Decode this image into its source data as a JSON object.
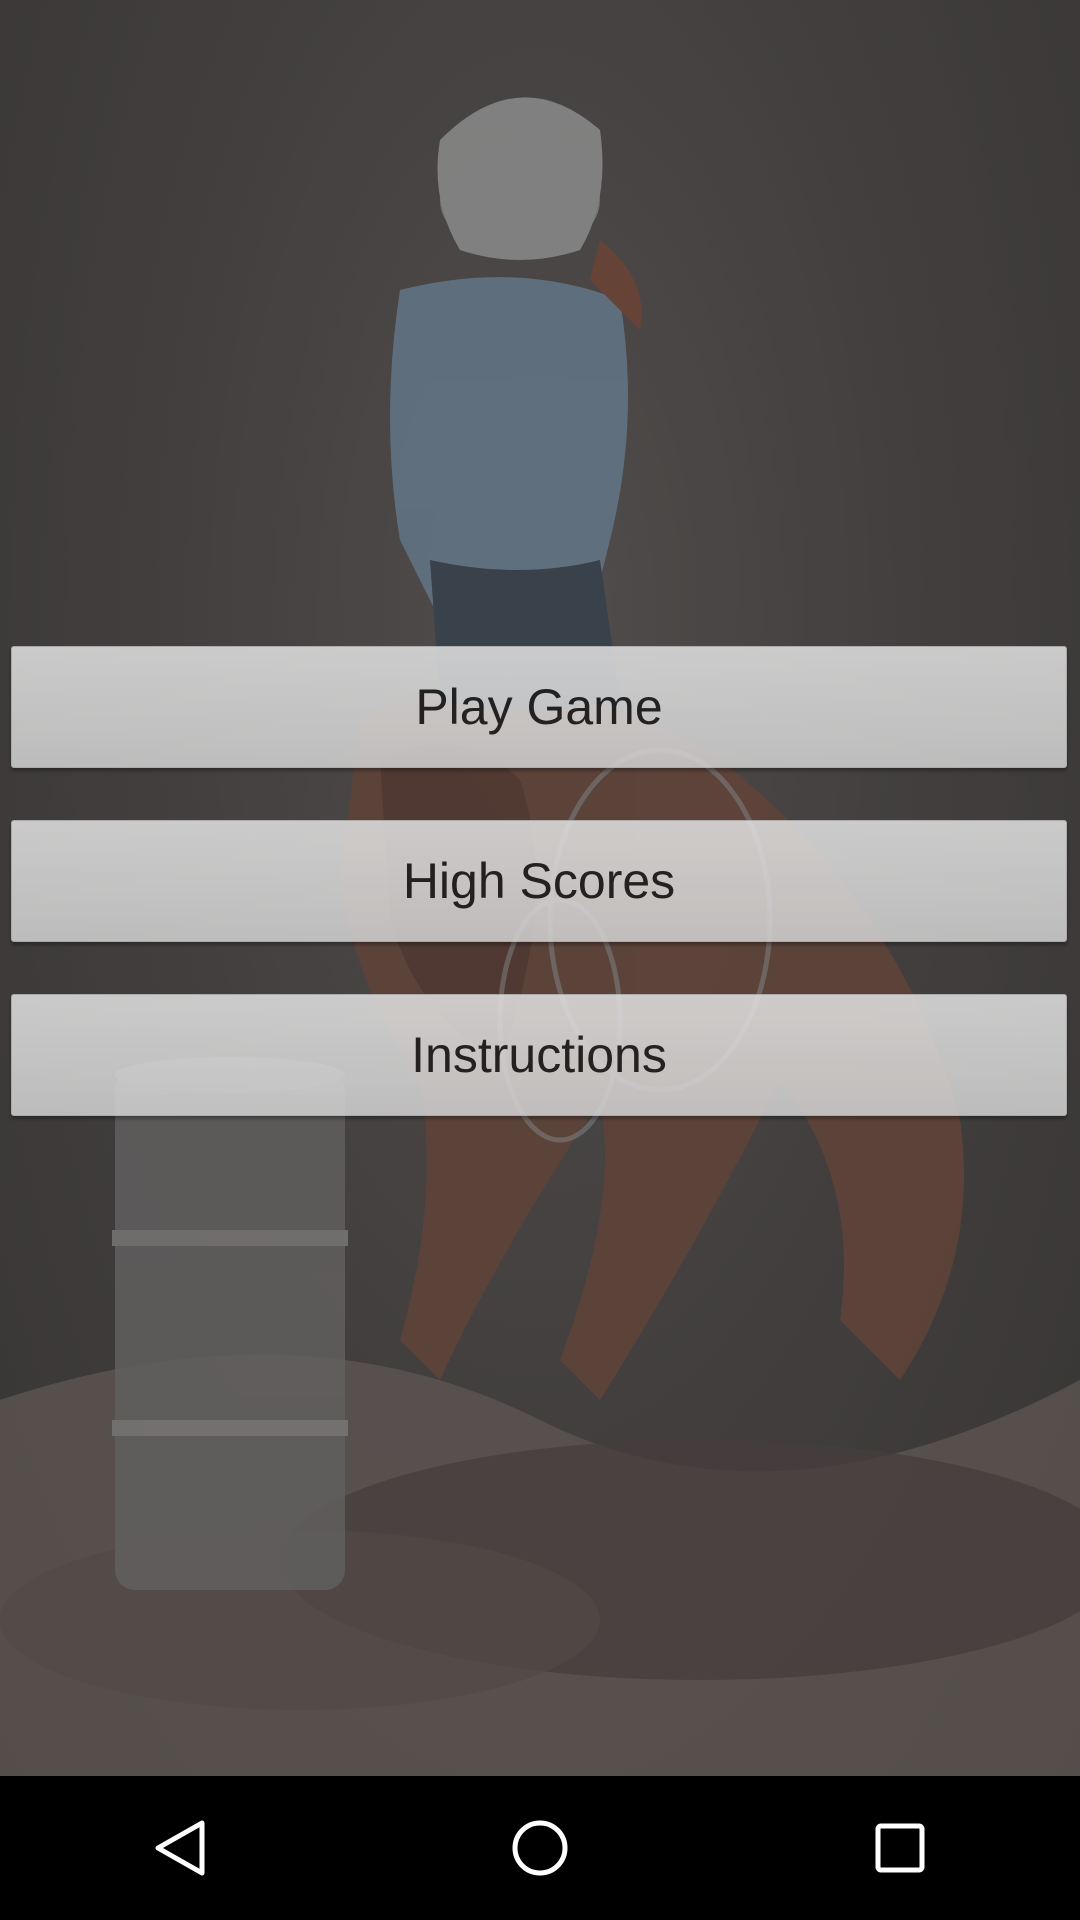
{
  "menu": {
    "play_label": "Play Game",
    "scores_label": "High Scores",
    "instructions_label": "Instructions"
  },
  "background": {
    "image": "cowgirl-barrel-racing-painting",
    "tint": "#4a4645"
  },
  "nav_bar": {
    "back_icon": "back-triangle-icon",
    "home_icon": "home-circle-icon",
    "recents_icon": "recents-square-icon",
    "color": "#ffffff"
  }
}
